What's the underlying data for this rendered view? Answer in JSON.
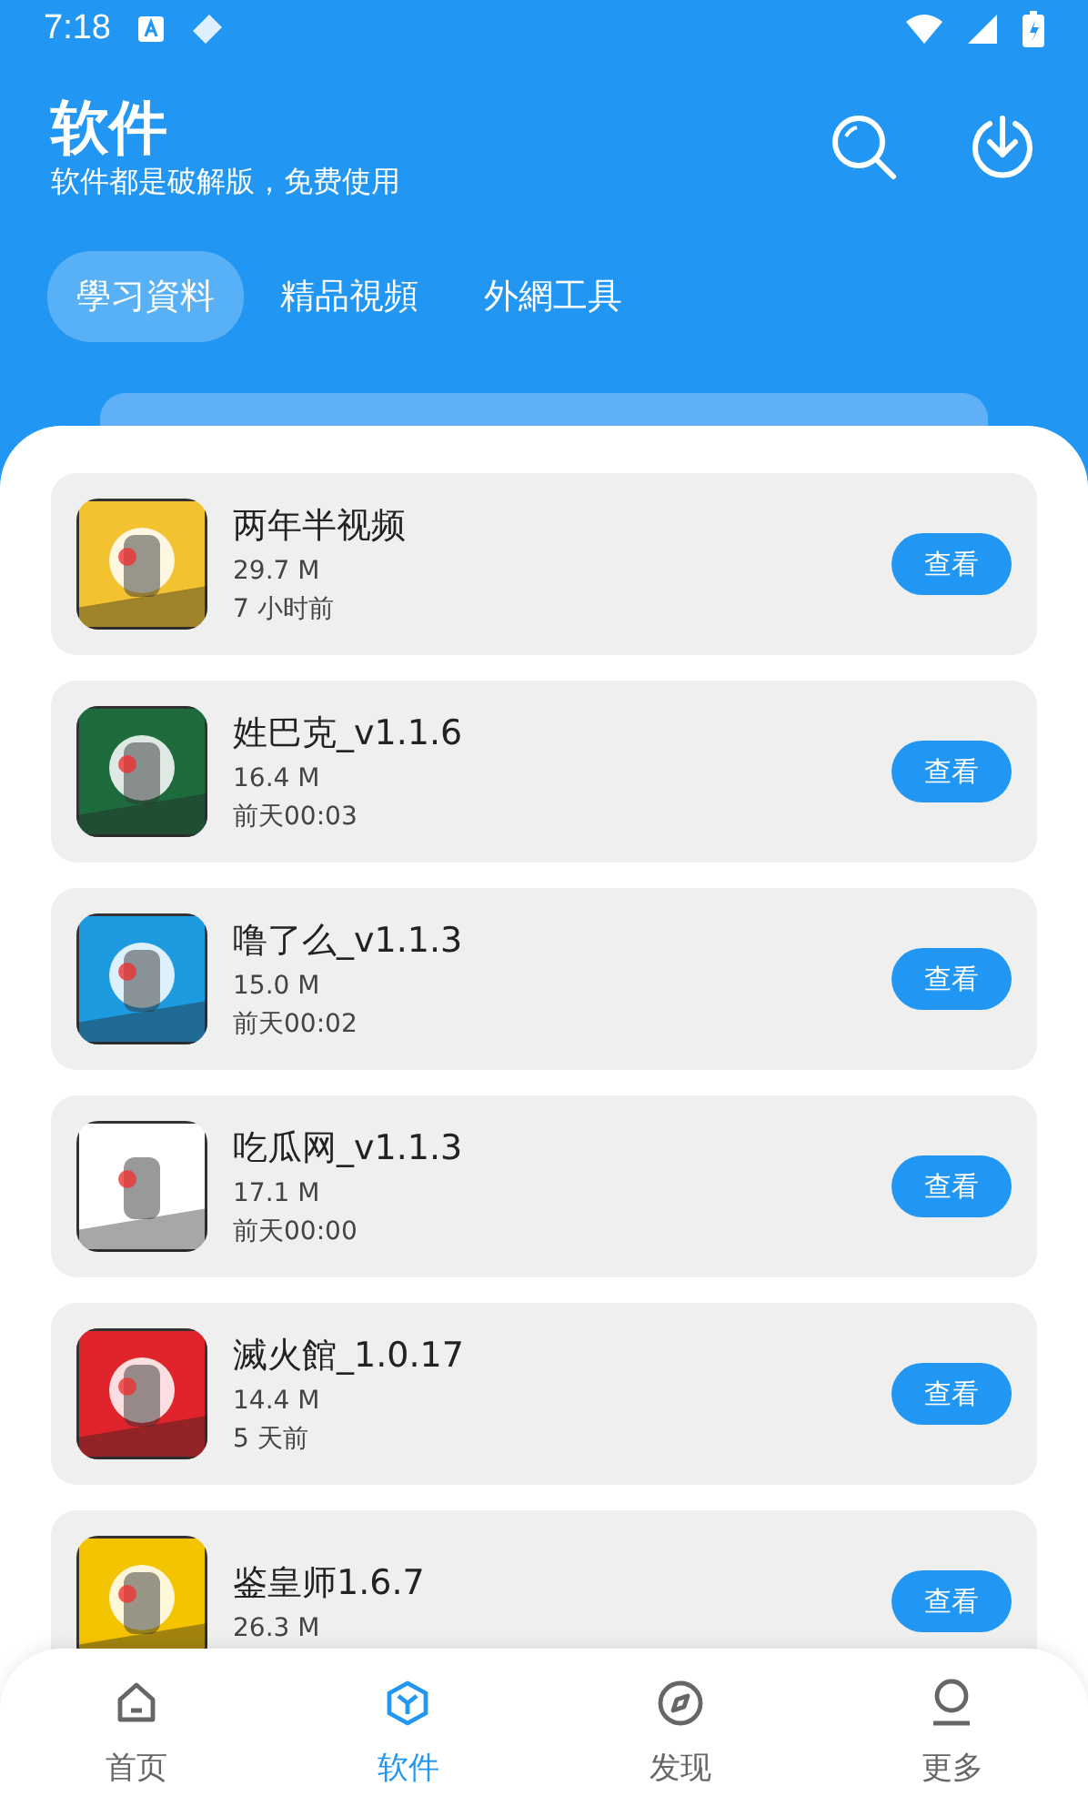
{
  "status_bar": {
    "time": "7:18"
  },
  "header": {
    "title": "软件",
    "subtitle": "软件都是破解版，免费使用"
  },
  "tabs": [
    {
      "label": "學习資料",
      "selected": true
    },
    {
      "label": "精品視頻",
      "selected": false
    },
    {
      "label": "外網工具",
      "selected": false
    }
  ],
  "apps": [
    {
      "name": "两年半视频",
      "size": "29.7 M",
      "time": "7 小时前",
      "action": "查看"
    },
    {
      "name": "姓巴克_v1.1.6",
      "size": "16.4 M",
      "time": "前天00:03",
      "action": "查看"
    },
    {
      "name": "噜了么_v1.1.3",
      "size": "15.0 M",
      "time": "前天00:02",
      "action": "查看"
    },
    {
      "name": "吃瓜网_v1.1.3",
      "size": "17.1 M",
      "time": "前天00:00",
      "action": "查看"
    },
    {
      "name": "滅火館_1.0.17",
      "size": "14.4 M",
      "time": "5 天前",
      "action": "查看"
    },
    {
      "name": "鉴皇师1.6.7",
      "size": "26.3 M",
      "action": "查看"
    }
  ],
  "nav": [
    {
      "label": "首页",
      "selected": false
    },
    {
      "label": "软件",
      "selected": true
    },
    {
      "label": "发现",
      "selected": false
    },
    {
      "label": "更多",
      "selected": false
    }
  ]
}
